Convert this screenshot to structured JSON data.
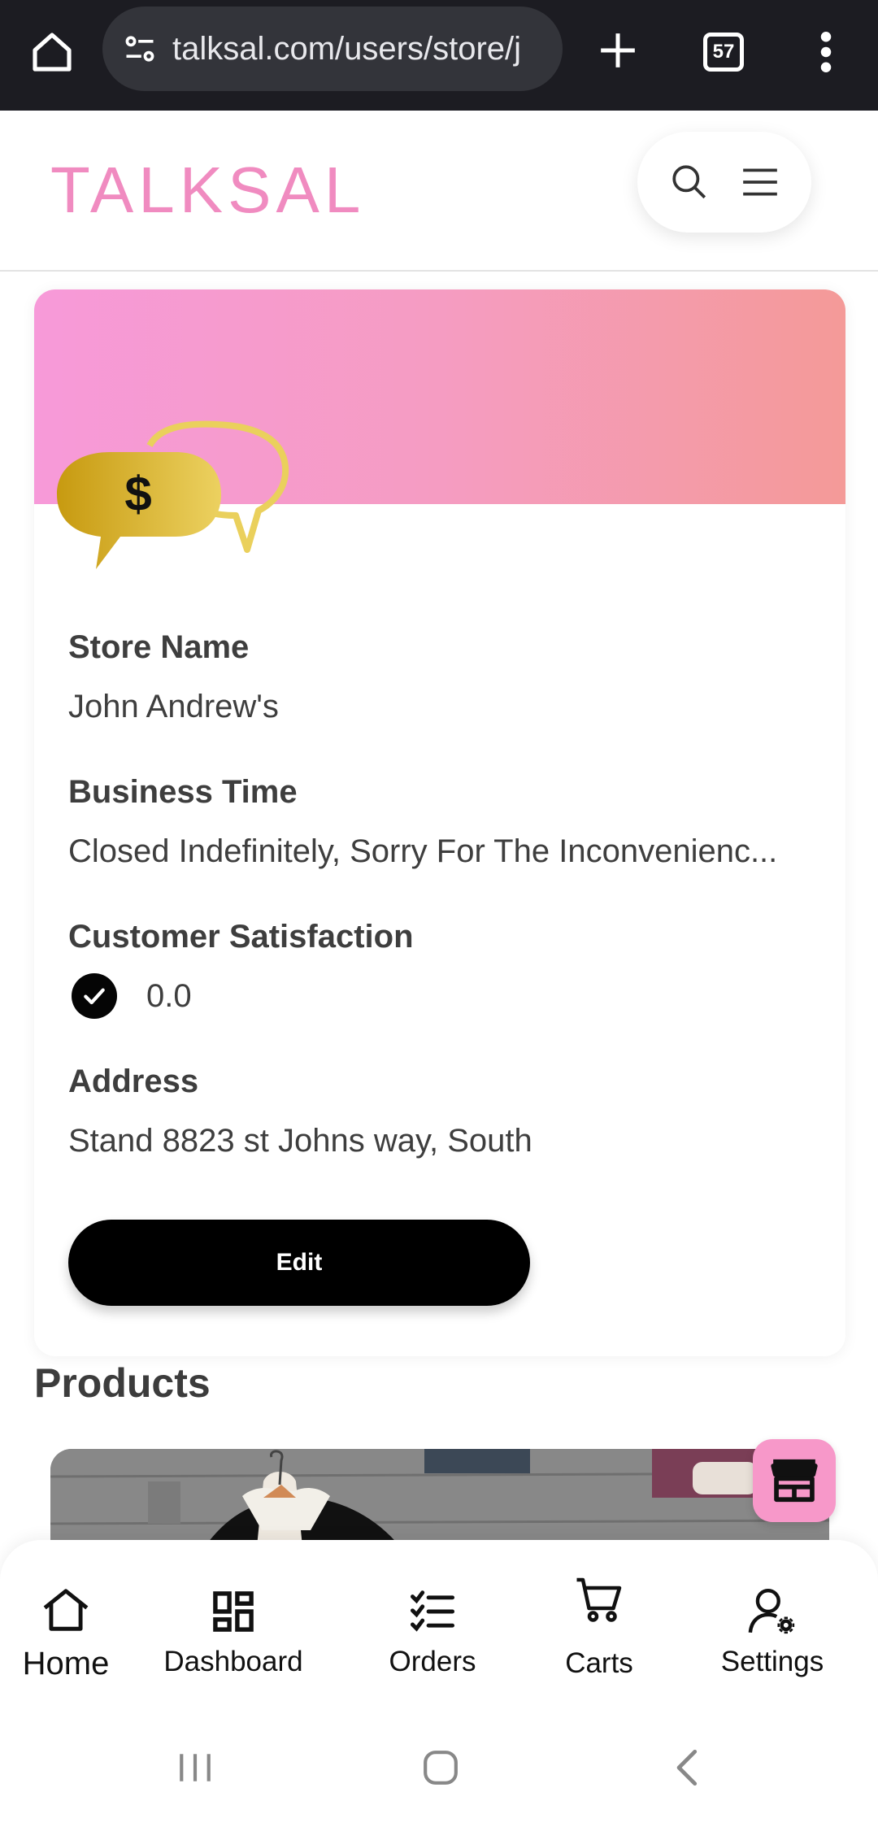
{
  "browser": {
    "url": "talksal.com/users/store/j",
    "tab_count": "57",
    "icons": [
      "home-icon",
      "site-settings-icon",
      "new-tab-icon",
      "tab-switcher-icon",
      "more-options-icon"
    ]
  },
  "header": {
    "logo": "TALKSAL",
    "icons": [
      "search-icon",
      "menu-icon"
    ],
    "logo_color": "#f08bc0"
  },
  "store": {
    "banner_colors": [
      "#f79ad9",
      "#f49a98"
    ],
    "name_label": "Store Name",
    "name_value": "John Andrew's",
    "time_label": "Business Time",
    "time_value": "Closed Indefinitely, Sorry For The Inconvenienc...",
    "satisfaction_label": "Customer Satisfaction",
    "satisfaction_value": "0.0",
    "address_label": "Address",
    "address_value": "Stand 8823 st Johns way, South",
    "edit_label": "Edit"
  },
  "products": {
    "title": "Products"
  },
  "bottom_nav": {
    "items": [
      {
        "label": "Home",
        "icon": "home-icon"
      },
      {
        "label": "Dashboard",
        "icon": "dashboard-icon"
      },
      {
        "label": "Orders",
        "icon": "orders-icon"
      },
      {
        "label": "Carts",
        "icon": "cart-icon"
      },
      {
        "label": "Settings",
        "icon": "user-settings-icon"
      }
    ]
  },
  "system_nav": {
    "icons": [
      "recents-icon",
      "home-icon",
      "back-icon"
    ]
  }
}
